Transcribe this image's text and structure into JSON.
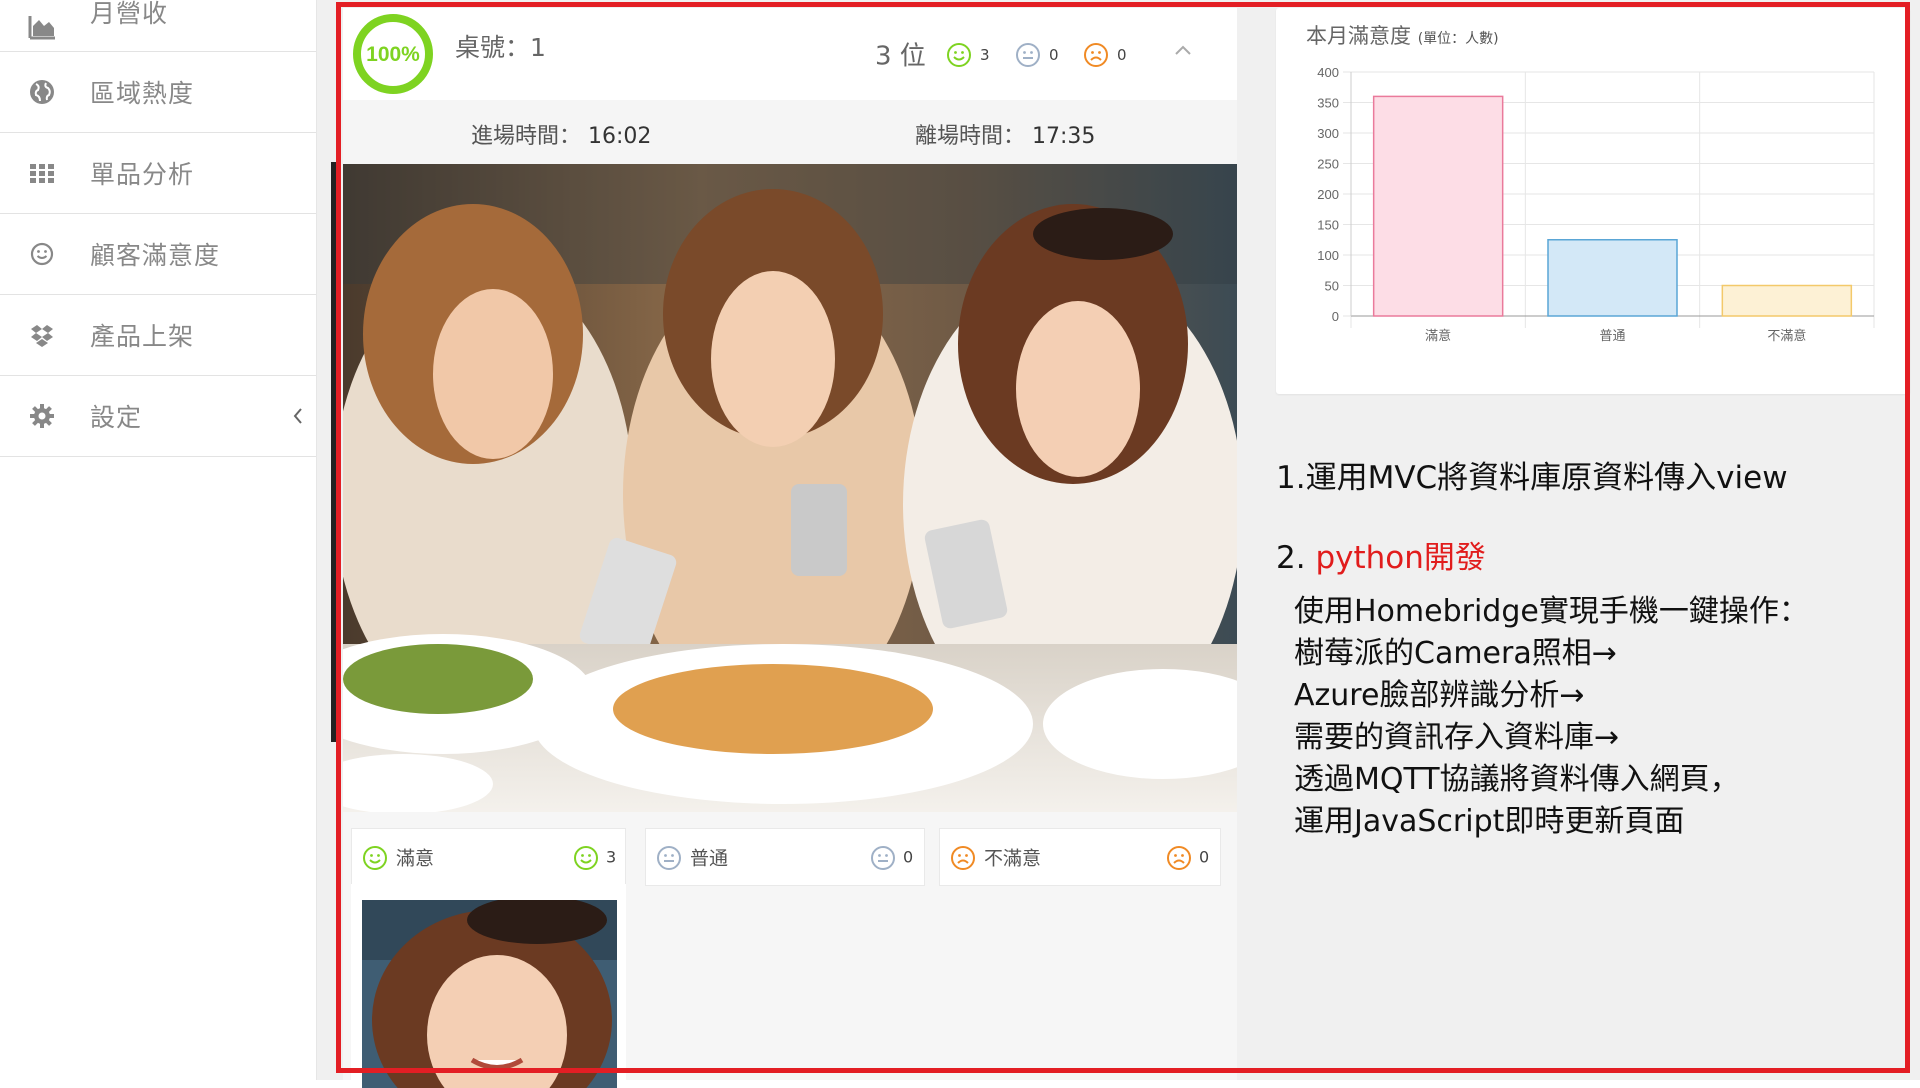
{
  "sidebar": {
    "items": [
      {
        "label": "月營收",
        "icon": "area-chart-icon"
      },
      {
        "label": "區域熱度",
        "icon": "globe-icon"
      },
      {
        "label": "單品分析",
        "icon": "grid-icon"
      },
      {
        "label": "顧客滿意度",
        "icon": "smile-icon"
      },
      {
        "label": "產品上架",
        "icon": "dropbox-icon"
      },
      {
        "label": "設定",
        "icon": "gear-icon"
      }
    ]
  },
  "table_card": {
    "progress_label": "100%",
    "progress_fraction": 1.0,
    "table_no": "桌號：1",
    "guests": "3 位",
    "mood_counts": {
      "satisfied": "3",
      "neutral": "0",
      "unsatisfied": "0"
    },
    "enter_label": "進場時間：",
    "enter_time": "16:02",
    "leave_label": "離場時間：",
    "leave_time": "17:35",
    "columns": [
      {
        "label": "滿意",
        "count": "3"
      },
      {
        "label": "普通",
        "count": "0"
      },
      {
        "label": "不滿意",
        "count": "0"
      }
    ]
  },
  "chart_title": "本月滿意度",
  "chart_unit": "(單位：人數)",
  "chart_data": {
    "type": "bar",
    "title": "本月滿意度 (單位：人數)",
    "categories": [
      "滿意",
      "普通",
      "不滿意"
    ],
    "values": [
      360,
      125,
      50
    ],
    "ylim": [
      0,
      400
    ],
    "yticks": [
      0,
      50,
      100,
      150,
      200,
      250,
      300,
      350,
      400
    ],
    "grid": true,
    "colors": {
      "fill": [
        "#fddde6",
        "#d3e8f7",
        "#fdf1d5"
      ],
      "stroke": [
        "#ea7a9b",
        "#5aa6d6",
        "#f3c96a"
      ]
    }
  },
  "notes": {
    "line1": "1.運用MVC將資料庫原資料傳入view",
    "line2_prefix": "2.",
    "line2_red": "python開發",
    "details": [
      "使用Homebridge實現手機一鍵操作：",
      "樹莓派的Camera照相→",
      "Azure臉部辨識分析→",
      "需要的資訊存入資料庫→",
      "透過MQTT協議將資料傳入網頁，",
      "運用JavaScript即時更新頁面"
    ]
  },
  "colors": {
    "accent_green": "#7ed321",
    "smile_green": "#7ed321",
    "frown_orange": "#f08a24",
    "highlight_red": "#e31e24"
  }
}
